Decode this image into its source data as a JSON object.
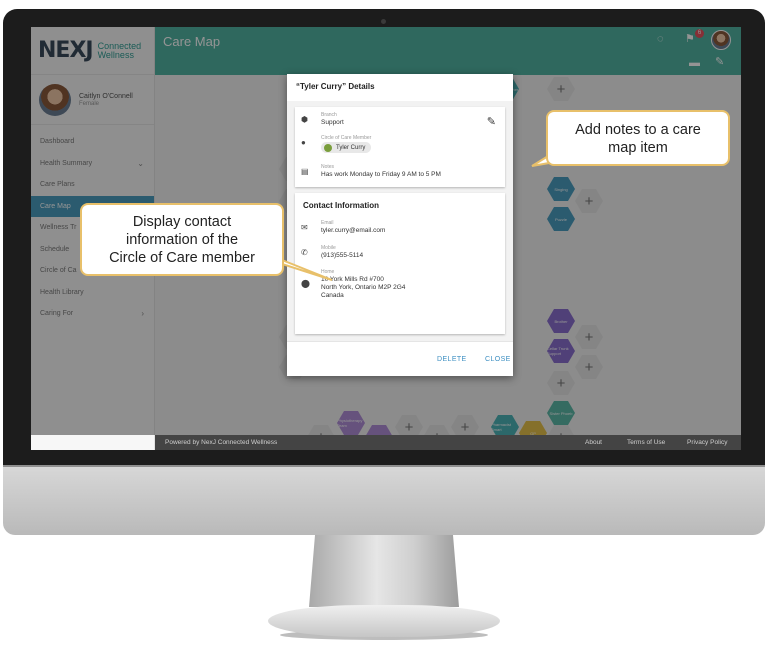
{
  "app": {
    "logo_mark": "NEXJ",
    "logo_line1": "Connected",
    "logo_line2": "Wellness",
    "page_title": "Care Map"
  },
  "profile": {
    "name": "Caitlyn O'Connell",
    "gender": "Female"
  },
  "nav": [
    {
      "label": "Dashboard",
      "chevron": ""
    },
    {
      "label": "Health Summary",
      "chevron": "⌄"
    },
    {
      "label": "Care Plans",
      "chevron": ""
    },
    {
      "label": "Care Map",
      "chevron": ""
    },
    {
      "label": "Wellness Tr",
      "chevron": ""
    },
    {
      "label": "Schedule",
      "chevron": ""
    },
    {
      "label": "Circle of Ca",
      "chevron": ""
    },
    {
      "label": "Health Library",
      "chevron": ""
    },
    {
      "label": "Caring For",
      "chevron": "›"
    }
  ],
  "topbar": {
    "notification_count": "6"
  },
  "map": {
    "labels": [
      "Prozac",
      "Elmor",
      "Go Ed Teacher",
      "Singing",
      "Puzzle",
      "Brother",
      "Cellar Trunk Support",
      "Sister Phoeb",
      "Physiotherapy Team",
      "Pharmacist Smart",
      "PT",
      "GP"
    ]
  },
  "dialog": {
    "title": "“Tyler Curry” Details",
    "branch_label": "Branch",
    "branch_value": "Support",
    "member_label": "Circle of Care Member",
    "member_value": "Tyler Curry",
    "notes_label": "Notes",
    "notes_value": "Has work Monday to Friday 9 AM to 5 PM",
    "contact_title": "Contact Information",
    "email_label": "Email",
    "email_value": "tyler.curry@email.com",
    "mobile_label": "Mobile",
    "mobile_value": "(913)555-5114",
    "home_label": "Home",
    "home_line1": "10 York Mills Rd #700",
    "home_line2": "North York, Ontario M2P 2G4",
    "home_line3": "Canada",
    "delete_label": "DELETE",
    "close_label": "CLOSE"
  },
  "footer": {
    "powered_by": "Powered by NexJ Connected Wellness",
    "about": "About",
    "terms": "Terms of Use",
    "privacy": "Privacy Policy"
  },
  "callouts": {
    "notes_line1": "Add notes to a care",
    "notes_line2": "map item",
    "contact_line1": "Display contact",
    "contact_line2": "information of the",
    "contact_line3": "Circle of Care member"
  },
  "colors": {
    "topbar": "#51b3a3",
    "nav_active": "#4a9ec0",
    "callout_border": "#e8c06a",
    "button_text": "#3d8fc2"
  }
}
